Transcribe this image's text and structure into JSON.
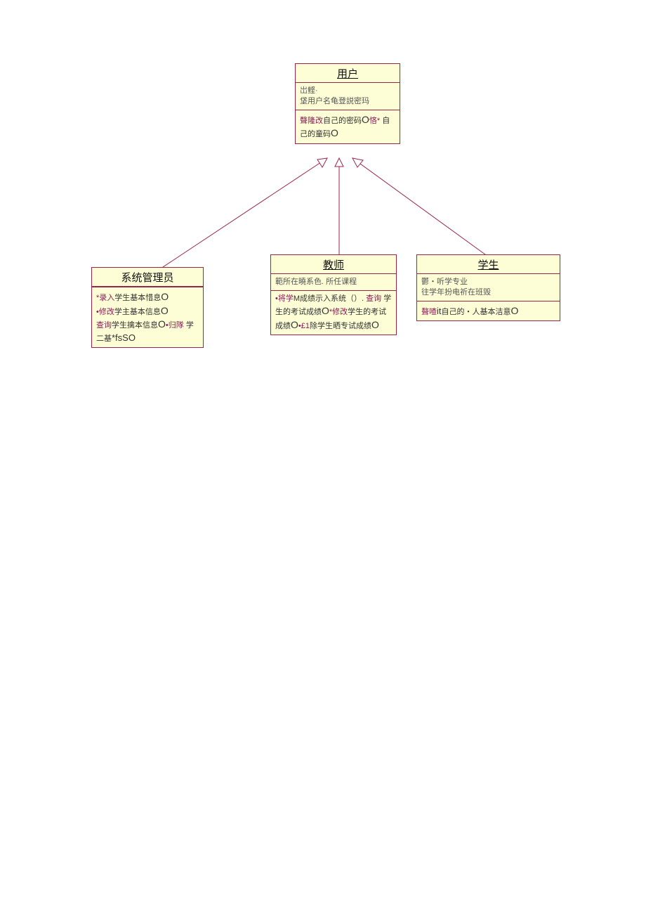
{
  "diagram": {
    "user": {
      "title": "用户",
      "attrs": "岀鲣·\n垡用户名龟登説密玛",
      "ops_hl1": "聲隆改",
      "ops_bk1": "自己的密码",
      "ops_big0_1": "O",
      "ops_hl2": "悋*",
      "ops_bk2": "自己的童码",
      "ops_big0_2": "O"
    },
    "admin": {
      "title": "系统管理员",
      "op1_hl": "*录入",
      "op1_bk": "学生基本惜息",
      "op1_0": "O",
      "op2_hl": "•修改",
      "op2_bk": "学主基本信息",
      "op2_0": "O",
      "op3_hl": "查询",
      "op3_bk": "学生擒本信息",
      "op3_0": "O",
      "op3_hl2": "•归隊",
      "op4_bk": "学二基",
      "op4_tail": "*fsSO"
    },
    "teacher": {
      "title": "教师",
      "attrs": "範所在曉系色. 所任课程",
      "op1_hl": "•将学",
      "op1_bk": "M成绩示入系统（）. ",
      "op1_hl2": "查询",
      "op2_bk": "学生的考试成绩",
      "op2_0": "O",
      "op2_hl": "*修改",
      "op2_bk2": "学生的考试成绩",
      "op2_0b": "O",
      "op2_hl2": "•£1",
      "op2_bk3": "除学生晒专试成绩",
      "op2_0c": "O"
    },
    "student": {
      "title": "学生",
      "attrs": "鬱・听学专业\n往学年扮电祈在班毁",
      "op1_hl": "聱喳",
      "op1_it": "it",
      "op1_bk": "自己的・人基本洁意",
      "op1_0": "O"
    }
  }
}
